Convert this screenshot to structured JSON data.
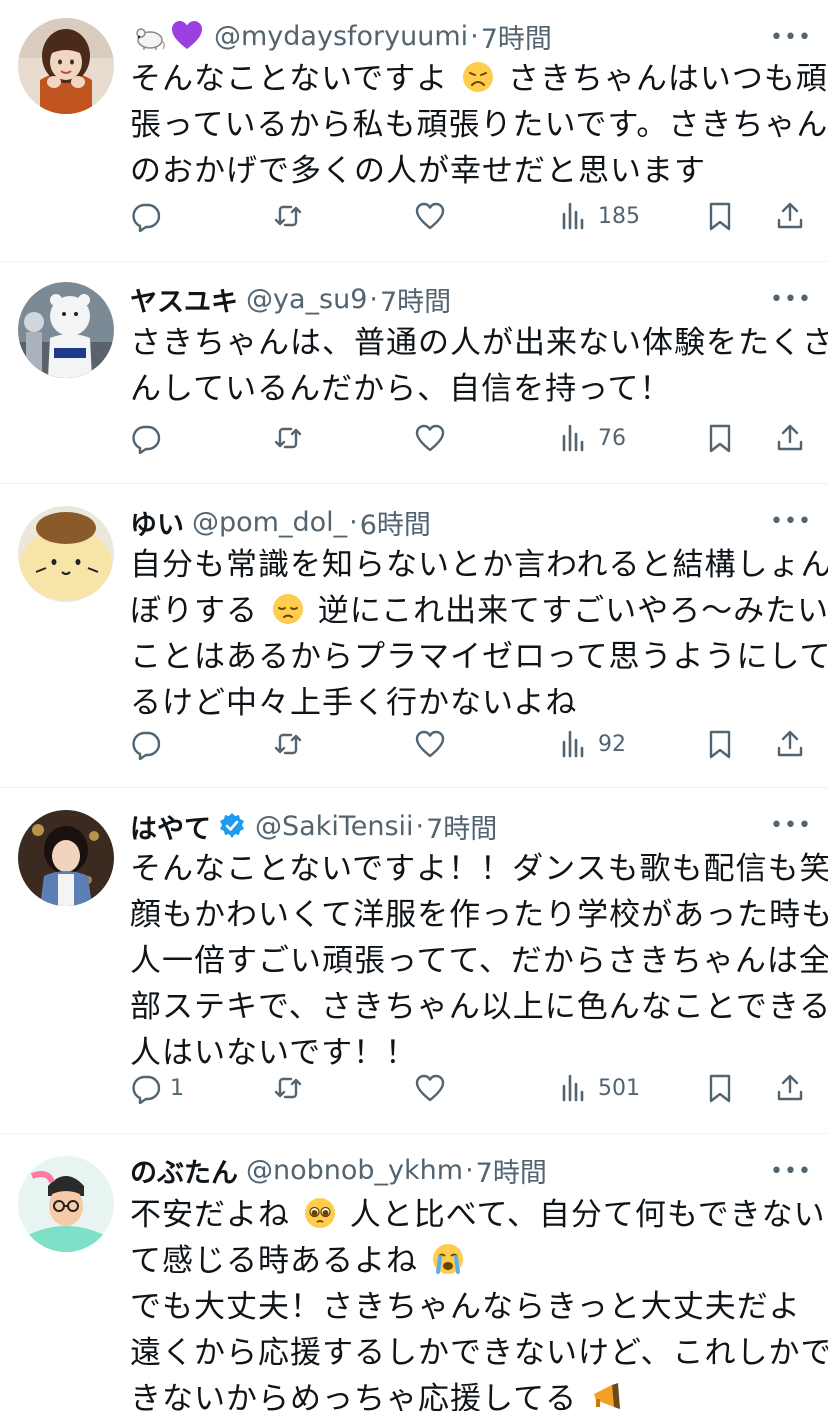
{
  "replies": [
    {
      "name": "",
      "handle": "@mydaysforyuumi",
      "time": "7時間",
      "lines": [
        "そんなことないですよ",
        "さきちゃんはいつも頑",
        "張っているから私も頑張りたいです。さきちゃん",
        "のおかげで多くの人が幸せだと思います"
      ],
      "replies_count": "",
      "views": "185"
    },
    {
      "name": "ヤスユキ",
      "handle": "@ya_su9",
      "time": "7時間",
      "lines": [
        "さきちゃんは、普通の人が出来ない体験をたくさ",
        "んしているんだから、自信を持って！"
      ],
      "replies_count": "",
      "views": "76"
    },
    {
      "name": "ゆい",
      "handle": "@pom_dol_",
      "time": "6時間",
      "lines": [
        "自分も常識を知らないとか言われると結構しょん",
        "ぼりする",
        "逆にこれ出来てすごいやろ〜みたいな",
        "ことはあるからプラマイゼロって思うようにして",
        "るけど中々上手く行かないよね"
      ],
      "replies_count": "",
      "views": "92"
    },
    {
      "name": "はやて",
      "handle": "@SakiTensii",
      "time": "7時間",
      "lines": [
        "そんなことないですよ！！ダンスも歌も配信も笑",
        "顔もかわいくて洋服を作ったり学校があった時も",
        "人一倍すごい頑張ってて、だからさきちゃんは全",
        "部ステキで、さきちゃん以上に色んなことできる",
        "人はいないです！！"
      ],
      "replies_count": "1",
      "views": "501"
    },
    {
      "name": "のぶたん",
      "handle": "@nobnob_ykhm",
      "time": "7時間",
      "lines": [
        "不安だよね",
        "人と比べて、自分て何もできないっ",
        "て感じる時あるよね",
        "でも大丈夫！さきちゃんならきっと大丈夫だよ",
        "遠くから応援するしかできないけど、これしかで",
        "きないからめっちゃ応援してる"
      ],
      "replies_count": "",
      "views": ""
    }
  ],
  "colors": {
    "text": "#0f1419",
    "muted": "#536471",
    "divider": "#eff3f4",
    "verified": "#1d9bf0"
  },
  "icons": [
    "rat-emoji",
    "purple-heart-emoji",
    "disappointed-face-emoji",
    "pensive-face-emoji",
    "pleading-face-emoji",
    "crying-face-emoji",
    "megaphone-emoji",
    "verified-badge-icon",
    "reply-icon",
    "retweet-icon",
    "like-icon",
    "views-icon",
    "bookmark-icon",
    "share-icon",
    "more-icon"
  ]
}
